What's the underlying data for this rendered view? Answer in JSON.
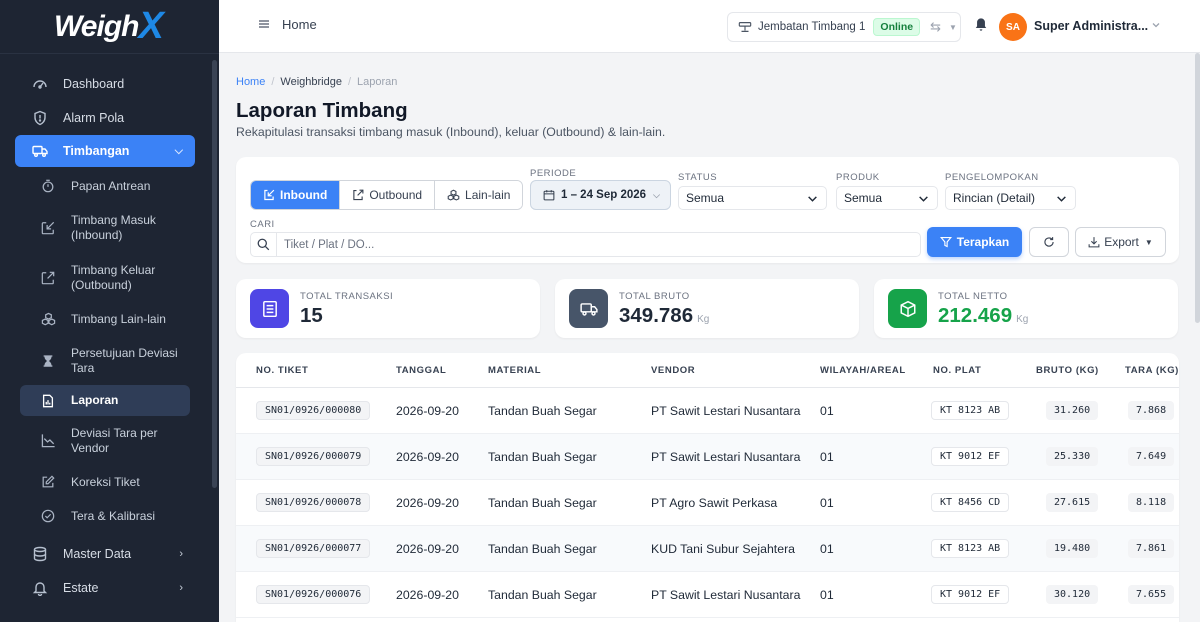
{
  "brand": {
    "logo_text": "Weigh",
    "logo_accent": "X"
  },
  "sidebar": {
    "items": [
      {
        "label": "Dashboard",
        "icon": "speedometer-icon"
      },
      {
        "label": "Alarm Pola",
        "icon": "shield-icon"
      },
      {
        "label": "Timbangan",
        "icon": "truck-icon",
        "active": true
      },
      {
        "label": "Master Data",
        "icon": "database-icon"
      },
      {
        "label": "Estate",
        "icon": "bell-icon"
      }
    ],
    "sub_items": [
      {
        "label": "Papan Antrean",
        "icon": "stopwatch-icon"
      },
      {
        "label": "Timbang Masuk (Inbound)",
        "icon": "box-arrow-in-icon"
      },
      {
        "label": "Timbang Keluar (Outbound)",
        "icon": "box-arrow-out-icon"
      },
      {
        "label": "Timbang Lain-lain",
        "icon": "boxes-icon"
      },
      {
        "label": "Persetujuan Deviasi Tara",
        "icon": "hourglass-icon"
      },
      {
        "label": "Laporan",
        "icon": "report-icon",
        "current": true
      },
      {
        "label": "Deviasi Tara per Vendor",
        "icon": "graph-icon"
      },
      {
        "label": "Koreksi Tiket",
        "icon": "pencil-square-icon"
      },
      {
        "label": "Tera & Kalibrasi",
        "icon": "check-circle-icon"
      }
    ]
  },
  "topbar": {
    "home": "Home",
    "station": "Jembatan Timbang 1",
    "station_status": "Online",
    "avatar_initials": "SA",
    "user_name": "Super Administra..."
  },
  "breadcrumb": {
    "home": "Home",
    "section": "Weighbridge",
    "current": "Laporan",
    "separator": "/"
  },
  "page": {
    "title": "Laporan Timbang",
    "subtitle": "Rekapitulasi transaksi timbang masuk (Inbound), keluar (Outbound) & lain-lain."
  },
  "filters": {
    "tabs": [
      "Inbound",
      "Outbound",
      "Lain-lain"
    ],
    "period_label": "PERIODE",
    "period_value": "1 – 24 Sep 2026",
    "status_label": "STATUS",
    "status_value": "Semua",
    "product_label": "PRODUK",
    "product_value": "Semua",
    "group_label": "PENGELOMPOKAN",
    "group_value": "Rincian (Detail)",
    "search_label": "CARI",
    "search_placeholder": "Tiket / Plat / DO...",
    "apply": "Terapkan",
    "export": "Export"
  },
  "stats": [
    {
      "label": "TOTAL TRANSAKSI",
      "value": "15",
      "unit": "",
      "color": "#4f46e5"
    },
    {
      "label": "TOTAL BRUTO",
      "value": "349.786",
      "unit": "Kg",
      "color": "#475569"
    },
    {
      "label": "TOTAL NETTO",
      "value": "212.469",
      "unit": "Kg",
      "color": "#16a34a"
    }
  ],
  "table": {
    "columns": [
      "NO. TIKET",
      "TANGGAL",
      "MATERIAL",
      "VENDOR",
      "WILAYAH/AREAL",
      "NO. PLAT",
      "BRUTO (KG)",
      "TARA (KG)"
    ],
    "rows": [
      [
        "SN01/0926/000080",
        "2026-09-20",
        "Tandan Buah Segar",
        "PT Sawit Lestari Nusantara",
        "01",
        "KT 8123 AB",
        "31.260",
        "7.868"
      ],
      [
        "SN01/0926/000079",
        "2026-09-20",
        "Tandan Buah Segar",
        "PT Sawit Lestari Nusantara",
        "01",
        "KT 9012 EF",
        "25.330",
        "7.649"
      ],
      [
        "SN01/0926/000078",
        "2026-09-20",
        "Tandan Buah Segar",
        "PT Agro Sawit Perkasa",
        "01",
        "KT 8456 CD",
        "27.615",
        "8.118"
      ],
      [
        "SN01/0926/000077",
        "2026-09-20",
        "Tandan Buah Segar",
        "KUD Tani Subur Sejahtera",
        "01",
        "KT 8123 AB",
        "19.480",
        "7.861"
      ],
      [
        "SN01/0926/000076",
        "2026-09-20",
        "Tandan Buah Segar",
        "PT Sawit Lestari Nusantara",
        "01",
        "KT 9012 EF",
        "30.120",
        "7.655"
      ]
    ]
  },
  "colors": {
    "primary": "#3b82f6",
    "sidebar": "#1e2533",
    "netto": "#16a34a",
    "online": "#15803d"
  }
}
